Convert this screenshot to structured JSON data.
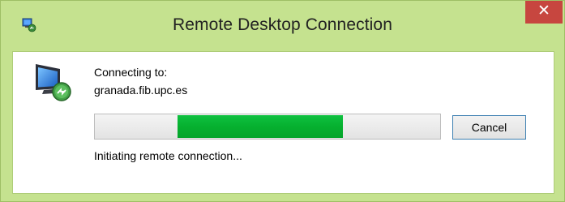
{
  "window": {
    "title": "Remote Desktop Connection",
    "close_label": "✕"
  },
  "dialog": {
    "connecting_label": "Connecting to:",
    "host": "granada.fib.upc.es",
    "status_text": "Initiating remote connection...",
    "cancel_label": "Cancel",
    "progress": {
      "style": "marquee",
      "segment_start_fraction": 0.24,
      "segment_end_fraction": 0.72
    }
  },
  "icons": {
    "title": "remote-desktop-icon",
    "main": "remote-desktop-computer-icon",
    "close": "close-icon"
  },
  "colors": {
    "frame": "#c5e28f",
    "close_button": "#c7463f",
    "progress_fill": "#06b02f",
    "button_focus_border": "#3c7fb1"
  }
}
